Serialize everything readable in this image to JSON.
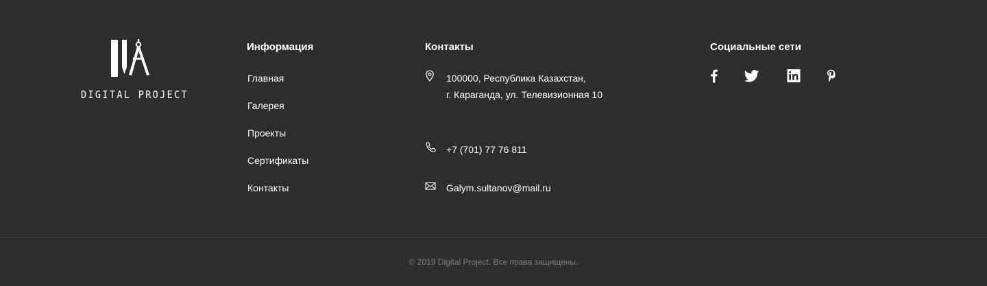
{
  "logo": {
    "text": "DIGITAL PROJECT",
    "icon": "compass-pencil-logo-icon"
  },
  "info": {
    "title": "Информация",
    "links": [
      "Главная",
      "Галерея",
      "Проекты",
      "Сертификаты",
      "Контакты"
    ]
  },
  "contacts": {
    "title": "Контакты",
    "address_line1": "100000, Республика  Казахстан,",
    "address_line2": "г. Караганда, ул. Телевизионная 10",
    "phone": "+7 (701) 77 76 811",
    "email": "Galym.sultanov@mail.ru",
    "icons": [
      "location-pin-icon",
      "phone-icon",
      "mail-icon"
    ]
  },
  "social": {
    "title": "Социальные сети",
    "icons": [
      "facebook-icon",
      "twitter-icon",
      "linkedin-icon",
      "pinterest-icon"
    ]
  },
  "copyright": "© 2019 Digital Project. Все права защищены.",
  "colors": {
    "background": "#2d2d2d",
    "text": "#ffffff",
    "divider": "#3a3a3a",
    "copyright": "#7d7d7d"
  }
}
